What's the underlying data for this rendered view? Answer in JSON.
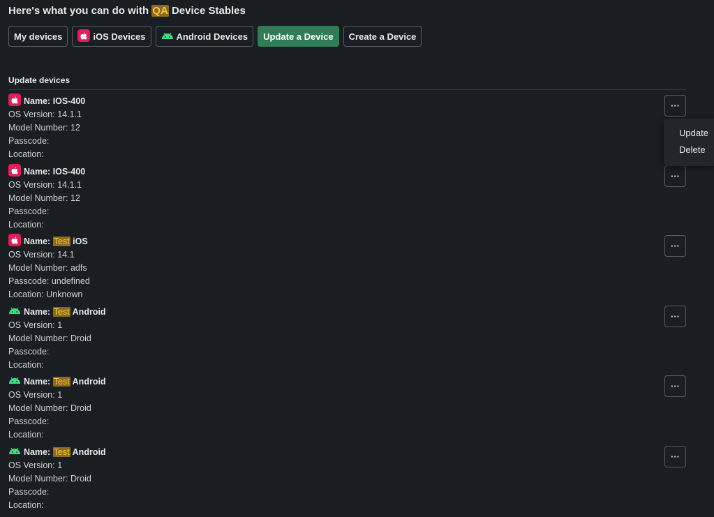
{
  "header": {
    "title_prefix": "Here's what you can do with",
    "title_highlight": "QA",
    "title_suffix": "Device Stables"
  },
  "actions": [
    {
      "label": "My devices",
      "icon": null
    },
    {
      "label": "iOS Devices",
      "icon": "apple-icon"
    },
    {
      "label": "Android Devices",
      "icon": "android-icon"
    },
    {
      "label": "Update a Device",
      "icon": null,
      "primary": true
    },
    {
      "label": "Create a Device",
      "icon": null
    }
  ],
  "section": {
    "title": "Update devices"
  },
  "labels": {
    "name": "Name:",
    "os": "OS Version:",
    "model": "Model Number:",
    "passcode": "Passcode:",
    "location": "Location:"
  },
  "devices": [
    {
      "platform": "ios",
      "name_highlight": "",
      "name_rest": "IOS-400",
      "os": "14.1.1",
      "model": "12",
      "passcode": "",
      "location": ""
    },
    {
      "platform": "ios",
      "name_highlight": "",
      "name_rest": "IOS-400",
      "os": "14.1.1",
      "model": "12",
      "passcode": "",
      "location": ""
    },
    {
      "platform": "ios",
      "name_highlight": "Test",
      "name_rest": "iOS",
      "os": "14.1",
      "model": "adfs",
      "passcode": "undefined",
      "location": "Unknown"
    },
    {
      "platform": "android",
      "name_highlight": "Test",
      "name_rest": "Android",
      "os": "1",
      "model": "Droid",
      "passcode": "",
      "location": ""
    },
    {
      "platform": "android",
      "name_highlight": "Test",
      "name_rest": "Android",
      "os": "1",
      "model": "Droid",
      "passcode": "",
      "location": ""
    },
    {
      "platform": "android",
      "name_highlight": "Test",
      "name_rest": "Android",
      "os": "1",
      "model": "Droid",
      "passcode": "",
      "location": ""
    }
  ],
  "overflow_menu": {
    "button_label": "···",
    "items": [
      "Update",
      "Delete"
    ]
  },
  "colors": {
    "background": "#1a1d21",
    "primary_button": "#2f7d55",
    "highlight": "#8c6a1e",
    "ios_badge": "#e01e5a",
    "android": "#3ddc84"
  }
}
